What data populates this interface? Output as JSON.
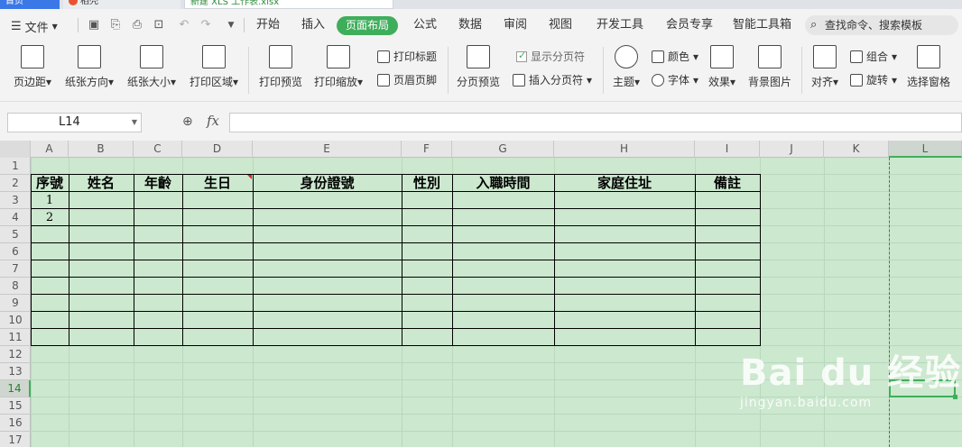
{
  "doc_tabs": [
    "首页",
    "稻壳",
    "新建 XLS 工作表.xlsx"
  ],
  "menu": {
    "file": "文件",
    "items": [
      "开始",
      "插入",
      "页面布局",
      "公式",
      "数据",
      "审阅",
      "视图",
      "开发工具",
      "会员专享",
      "智能工具箱"
    ],
    "active": "页面布局",
    "search_placeholder": "查找命令、搜索模板"
  },
  "ribbon": {
    "margins": "页边距",
    "orientation": "纸张方向",
    "size": "纸张大小",
    "print_area": "打印区域",
    "print_preview": "打印预览",
    "print_scale": "打印缩放",
    "print_titles": "打印标题",
    "header_footer": "页眉页脚",
    "page_break_preview": "分页预览",
    "show_page_breaks": "显示分页符",
    "insert_page_break": "插入分页符",
    "theme": "主题",
    "colors": "颜色",
    "fonts": "字体",
    "effects": "效果",
    "background": "背景图片",
    "align": "对齐",
    "group": "组合",
    "rotate": "旋转",
    "selection_pane": "选择窗格"
  },
  "formula_bar": {
    "cell_ref": "L14",
    "fx": "fx",
    "value": ""
  },
  "columns": [
    "A",
    "B",
    "C",
    "D",
    "E",
    "F",
    "G",
    "H",
    "I",
    "J",
    "K",
    "L"
  ],
  "rows": [
    "1",
    "2",
    "3",
    "4",
    "5",
    "6",
    "7",
    "8",
    "9",
    "10",
    "11",
    "12",
    "13",
    "14",
    "15",
    "16",
    "17"
  ],
  "table": {
    "headers": [
      "序號",
      "姓名",
      "年齡",
      "生日",
      "身份證號",
      "性別",
      "入職時間",
      "家庭住址",
      "備註"
    ],
    "row_numbers": [
      "1",
      "2"
    ]
  },
  "watermark": {
    "main": "Bai du 经验",
    "sub": "jingyan.baidu.com"
  },
  "colors": {
    "accent": "#3fae5b",
    "sheet_bg": "#cce8cf"
  }
}
